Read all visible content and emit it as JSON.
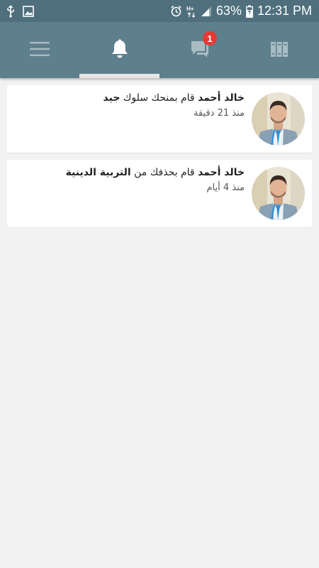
{
  "status_bar": {
    "icons_left": [
      "usb-icon",
      "image-icon"
    ],
    "icons_right": [
      "alarm-icon",
      "network-hplus-icon",
      "signal-icon",
      "battery-charging-icon"
    ],
    "battery": "63%",
    "time": "12:31 PM"
  },
  "nav": {
    "tabs": [
      {
        "icon": "menu-icon"
      },
      {
        "icon": "bell-icon",
        "selected": true
      },
      {
        "icon": "chat-icon",
        "badge": "1"
      },
      {
        "icon": "books-icon"
      }
    ]
  },
  "notifications": [
    {
      "name": "خالد أحمد",
      "action": " قام بمنحك سلوك ",
      "object": "جيد",
      "time": "منذ 21 دقيقة"
    },
    {
      "name": "خالد أحمد",
      "action": " قام بحذفك من ",
      "object": "التربية الدينية",
      "time": "منذ 4 أيام"
    }
  ],
  "colors": {
    "status_bar": "#4f6f7d",
    "nav_bar": "#5e7f8c",
    "badge": "#e53935",
    "background": "#f2f2f2"
  }
}
